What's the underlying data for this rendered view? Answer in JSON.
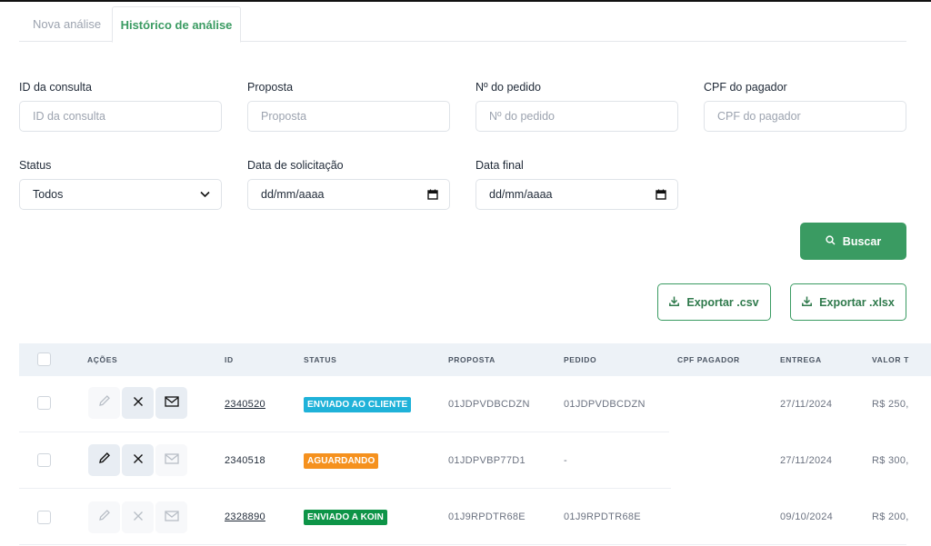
{
  "tabs": [
    {
      "label": "Nova análise",
      "active": false
    },
    {
      "label": "Histórico de análise",
      "active": true
    }
  ],
  "filters": {
    "id_consulta": {
      "label": "ID da consulta",
      "placeholder": "ID da consulta"
    },
    "proposta": {
      "label": "Proposta",
      "placeholder": "Proposta"
    },
    "pedido": {
      "label": "Nº do pedido",
      "placeholder": "Nº do pedido"
    },
    "cpf": {
      "label": "CPF do pagador",
      "placeholder": "CPF do pagador"
    },
    "status": {
      "label": "Status",
      "value": "Todos"
    },
    "data_solicitacao": {
      "label": "Data de solicitação",
      "value": "dd/mm/aaaa"
    },
    "data_final": {
      "label": "Data final",
      "value": "dd/mm/aaaa"
    }
  },
  "actions": {
    "search_label": "Buscar",
    "export_csv_label": "Exportar .csv",
    "export_xlsx_label": "Exportar .xlsx"
  },
  "table": {
    "headers": [
      "AÇÕES",
      "ID",
      "STATUS",
      "PROPOSTA",
      "PEDIDO",
      "CPF PAGADOR",
      "ENTREGA",
      "VALOR T"
    ],
    "rows": [
      {
        "id": "2340520",
        "id_link": true,
        "status": "ENVIADO AO CLIENTE",
        "status_color": "#1fb2d9",
        "proposta": "01JDPVDBCDZN",
        "pedido": "01JDPVDBCDZN",
        "cpf": "",
        "entrega": "27/11/2024",
        "valor": "R$ 250,",
        "edit_enabled": false,
        "cancel_enabled": true,
        "email_enabled": true
      },
      {
        "id": "2340518",
        "id_link": false,
        "status": "AGUARDANDO",
        "status_color": "#f5911e",
        "proposta": "01JDPVBP77D1",
        "pedido": "-",
        "cpf": "",
        "entrega": "27/11/2024",
        "valor": "R$ 300,",
        "edit_enabled": true,
        "cancel_enabled": true,
        "email_enabled": false
      },
      {
        "id": "2328890",
        "id_link": true,
        "status": "ENVIADO A KOIN",
        "status_color": "#0d9447",
        "proposta": "01J9RPDTR68E",
        "pedido": "01J9RPDTR68E",
        "cpf": "",
        "entrega": "09/10/2024",
        "valor": "R$ 200,",
        "edit_enabled": false,
        "cancel_enabled": false,
        "email_enabled": false
      }
    ]
  },
  "colors": {
    "brand": "#3a9b62",
    "header_bg": "#edf2f7"
  }
}
